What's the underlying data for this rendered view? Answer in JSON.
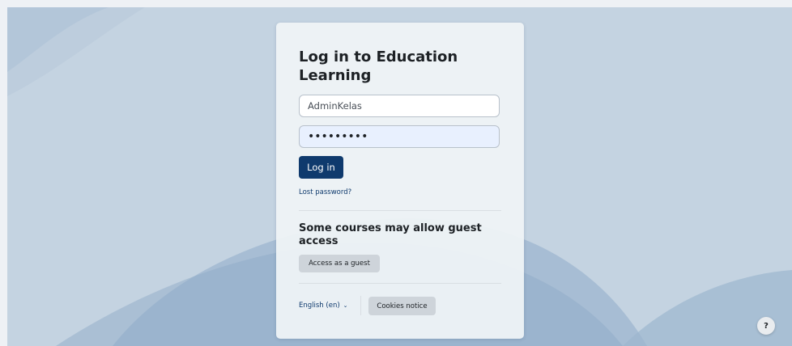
{
  "page": {
    "background_color": "#c4d3e1",
    "accent_color": "#0f3a6d"
  },
  "login": {
    "title": "Log in to Education Learning",
    "username_value": "AdminKelas",
    "password_value": "•••••••••",
    "login_button": "Log in",
    "lost_password": "Lost password?"
  },
  "guest": {
    "heading": "Some courses may allow guest access",
    "button": "Access as a guest"
  },
  "footer": {
    "language": "English (en)",
    "language_icon": "chevron-down-icon",
    "cookies_button": "Cookies notice"
  },
  "help": {
    "icon": "question-icon",
    "label": "?"
  }
}
